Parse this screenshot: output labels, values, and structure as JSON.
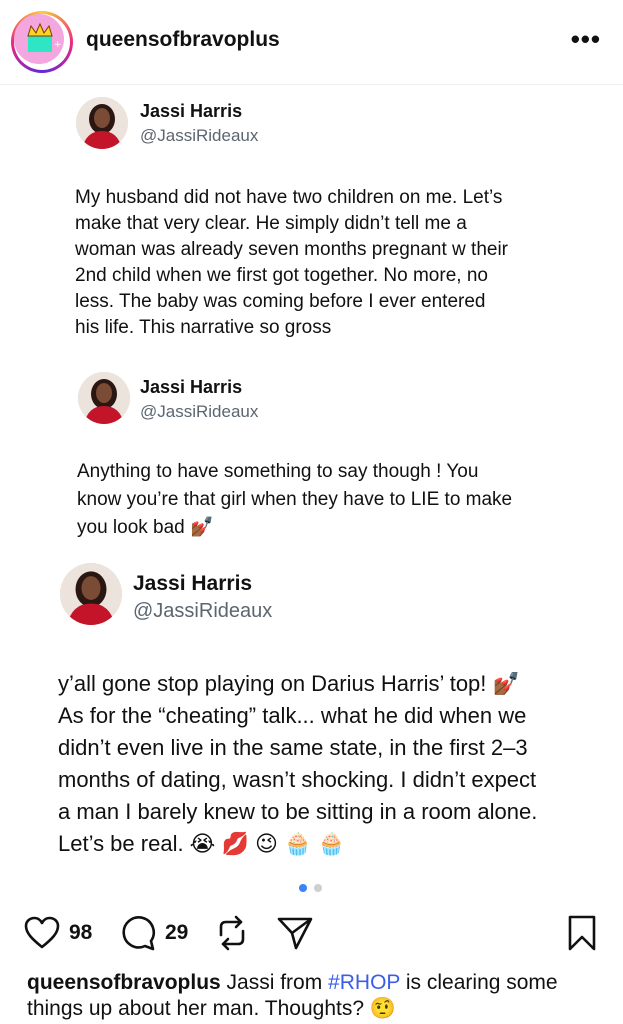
{
  "post": {
    "username": "queensofbravoplus",
    "more_label": "•••"
  },
  "tweets": [
    {
      "name": "Jassi Harris",
      "handle": "@JassiRideaux",
      "lines": [
        "My husband did not have two children on me. Let’s",
        "make that very clear. He simply didn’t tell me a",
        "woman was already seven months pregnant w their",
        "2nd child when we first got together. No more, no",
        "less. The baby was coming before I ever entered",
        "his life. This narrative so gross"
      ]
    },
    {
      "name": "Jassi Harris",
      "handle": "@JassiRideaux",
      "lines": [
        "Anything to have something to say though ! You",
        "know you’re that girl when they have to LIE to make",
        "you look bad 💅🏾"
      ]
    },
    {
      "name": "Jassi Harris",
      "handle": "@JassiRideaux",
      "lines": [
        "y’all gone stop playing on Darius Harris’ top! 💅🏾",
        "As for the “cheating” talk... what he did when we",
        "didn’t even live in the same state, in the first 2–3",
        "months of dating, wasn’t shocking. I didn’t expect",
        "a man I barely knew to be sitting in a room alone.",
        "Let’s be real. 😭 💋 😉 🧁 🧁"
      ]
    }
  ],
  "carousel": {
    "total": 2,
    "active": 1
  },
  "actions": {
    "likes": "98",
    "comments": "29",
    "icons": [
      "heart-icon",
      "comment-icon",
      "repost-icon",
      "share-icon",
      "bookmark-icon"
    ]
  },
  "caption": {
    "username": "queensofbravoplus",
    "text_before": " Jassi from ",
    "hashtag": "#RHOP",
    "text_after": " is clearing some things up about her man. Thoughts? 🤨"
  },
  "colors": {
    "accent_blue": "#3b5de7",
    "handle_gray": "#5b6670",
    "dot_active": "#3b82f6",
    "dot_inactive": "#cfcfcf"
  }
}
